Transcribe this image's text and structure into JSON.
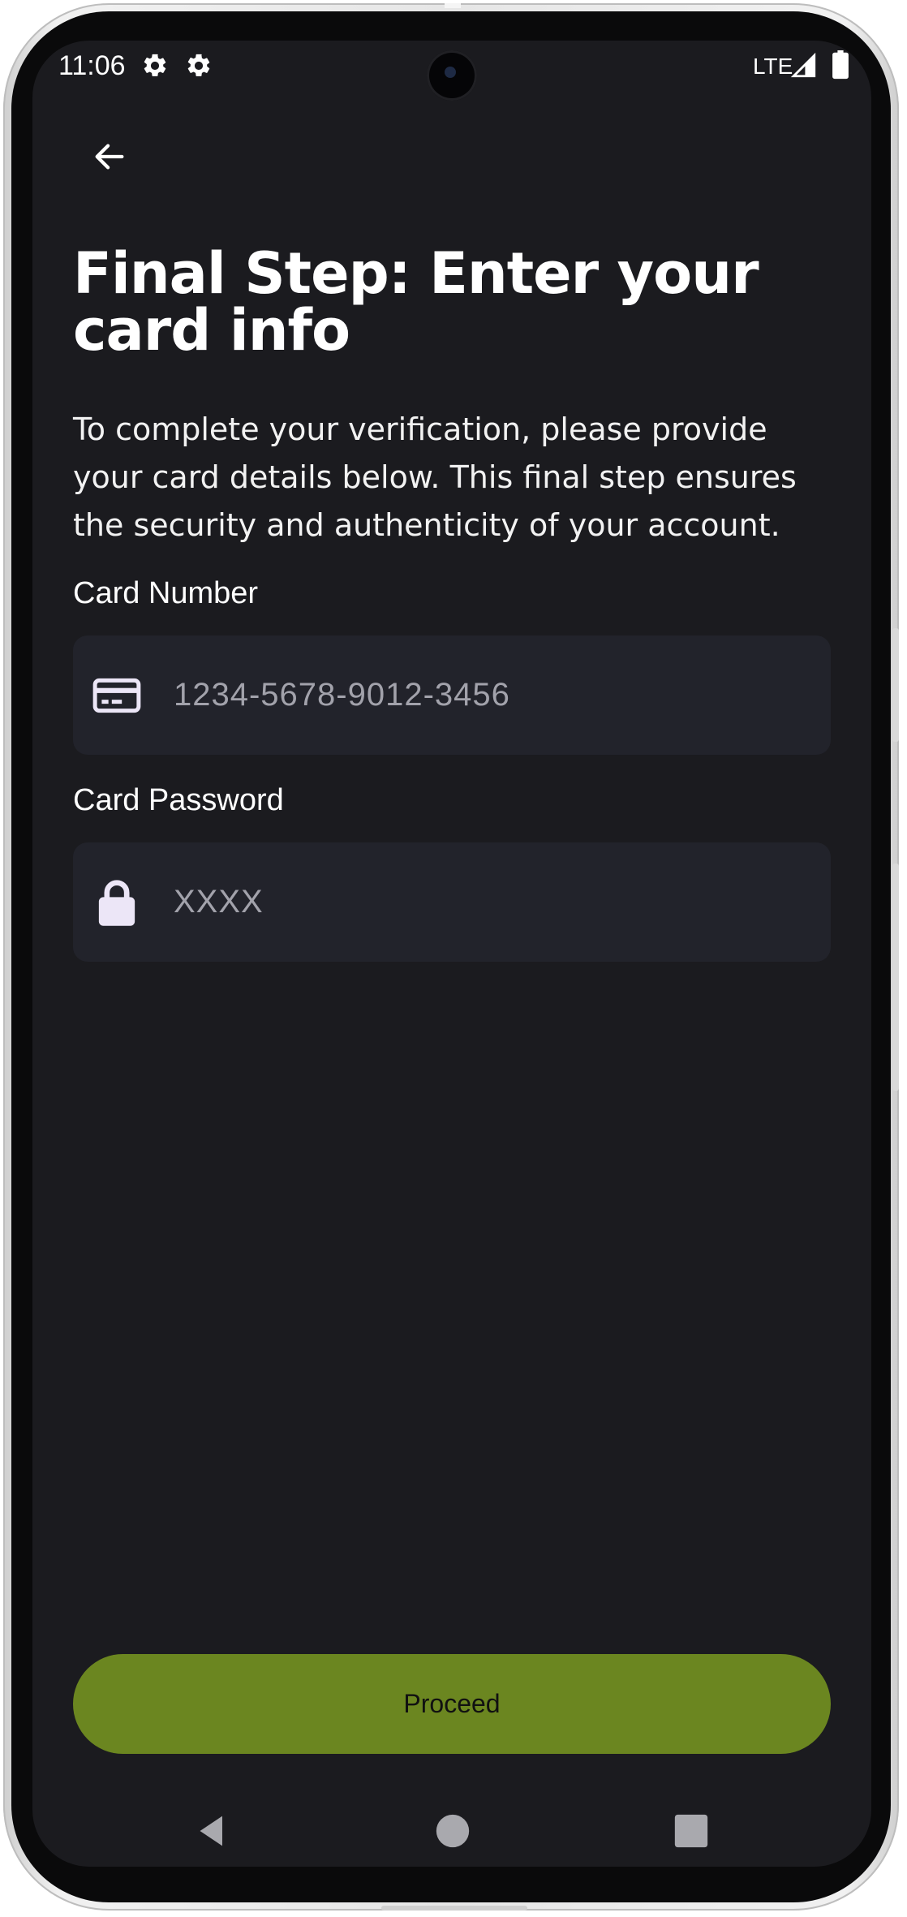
{
  "status_bar": {
    "time": "11:06",
    "network": "LTE",
    "icons": [
      "gear-icon",
      "gear-icon",
      "signal-icon",
      "battery-icon"
    ]
  },
  "header": {
    "back_icon": "arrow-left-icon",
    "title": "Final Step: Enter your card info",
    "description": "To complete your verification, please provide your card details below. This final step ensures the security and authenticity of your account."
  },
  "form": {
    "card_number": {
      "label": "Card Number",
      "placeholder": "1234-5678-9012-3456",
      "value": "",
      "icon": "credit-card-icon"
    },
    "card_password": {
      "label": "Card Password",
      "placeholder": "XXXX",
      "value": "",
      "icon": "lock-icon"
    }
  },
  "actions": {
    "proceed_label": "Proceed"
  },
  "nav_bar": {
    "buttons": [
      "back-triangle-icon",
      "home-circle-icon",
      "recents-square-icon"
    ]
  },
  "colors": {
    "background": "#1b1b1f",
    "field_background": "#22232b",
    "accent": "#6b8620",
    "placeholder": "#a2a2ab"
  }
}
